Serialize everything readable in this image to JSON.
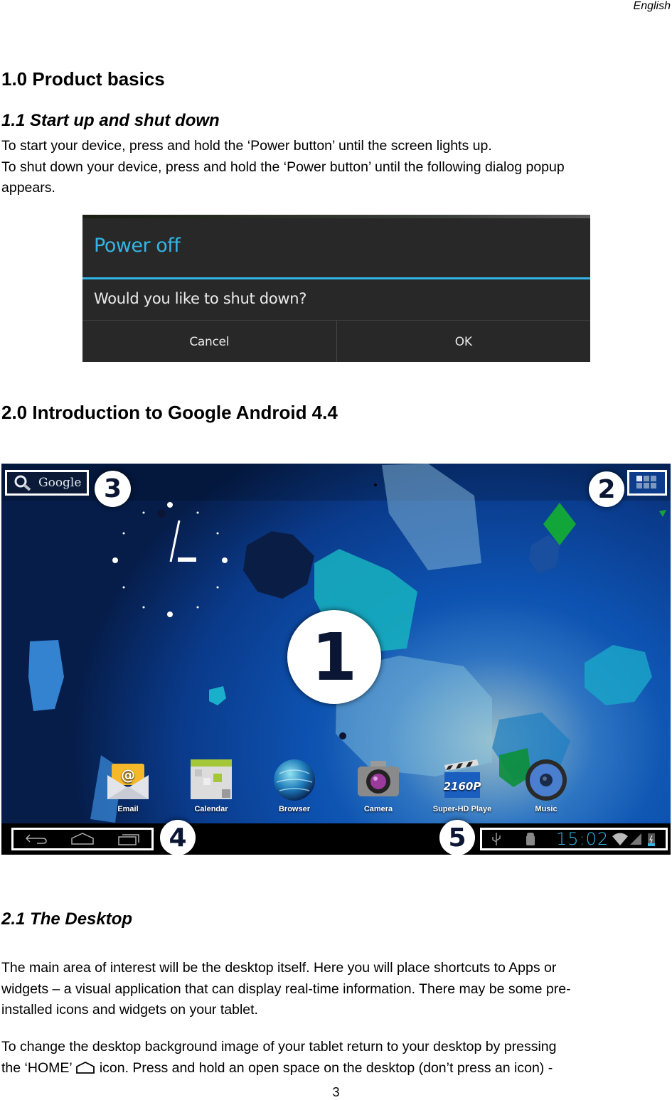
{
  "header": {
    "language": "English"
  },
  "section1": {
    "heading": "1.0 Product basics",
    "subheading": "1.1 Start up and shut down",
    "lines": [
      "To start your device, press and hold the ‘Power button’ until the screen lights up.",
      "To shut down your device, press and hold the ‘Power button’ until the following dialog popup",
      "appears."
    ]
  },
  "power_dialog": {
    "title": "Power off",
    "message": "Would you like to shut down?",
    "cancel_label": "Cancel",
    "ok_label": "OK",
    "accent_color": "#33b5e5"
  },
  "section2": {
    "heading": "2.0 Introduction to Google Android 4.4"
  },
  "android_screen": {
    "search_label": "Google",
    "callouts": [
      "1",
      "2",
      "3",
      "4",
      "5"
    ],
    "apps": [
      {
        "label": "Email",
        "icon": "email-icon"
      },
      {
        "label": "Calendar",
        "icon": "calendar-icon"
      },
      {
        "label": "Browser",
        "icon": "browser-icon"
      },
      {
        "label": "Camera",
        "icon": "camera-icon"
      },
      {
        "label": "Super-HD Playe",
        "icon": "video-player-icon",
        "badge_text": "2160P"
      },
      {
        "label": "Music",
        "icon": "music-icon"
      }
    ],
    "nav_buttons": [
      "back-icon",
      "home-icon",
      "recent-apps-icon"
    ],
    "status": {
      "time": "15:02",
      "icons": [
        "usb-icon",
        "android-debug-icon",
        "wifi-icon",
        "signal-icon",
        "battery-charging-icon"
      ]
    },
    "clock_widget": "analog-clock"
  },
  "section2_1": {
    "subheading": "2.1 The Desktop",
    "para1_lines": [
      "The main area of interest will be the desktop itself. Here you will place shortcuts to Apps or",
      "widgets – a visual application that can display real-time information. There may be some pre-",
      "installed icons and widgets on your tablet."
    ],
    "para2_line1": "To change the desktop background image of your tablet return to your desktop by pressing",
    "para2_line2_before": "the ‘HOME’",
    "para2_line2_after": "icon. Press and hold an open space on the desktop (don’t press an icon) -"
  },
  "footer": {
    "page_number": "3"
  }
}
